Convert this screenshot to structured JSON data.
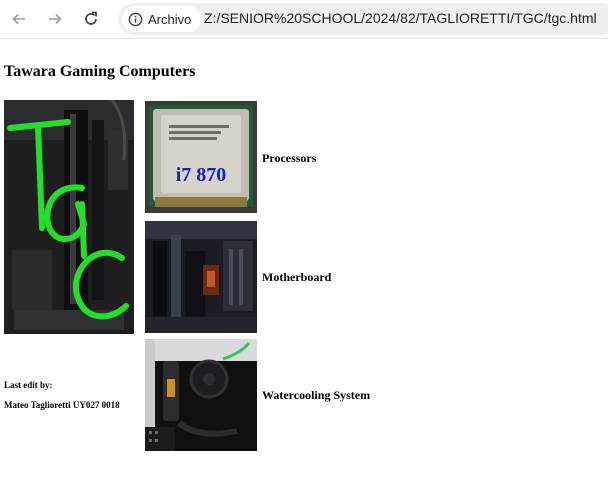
{
  "browser": {
    "site_chip_label": "Archivo",
    "url": "Z:/SENIOR%20SCHOOL/2024/82/TAGLIORETTI/TGC/tgc.html"
  },
  "page": {
    "title": "Tawara Gaming Computers",
    "logo_text": "TGC",
    "rows": [
      {
        "label": "Processors",
        "image_caption": "i7 870"
      },
      {
        "label": "Motherboard"
      },
      {
        "label": "Watercooling System"
      }
    ],
    "footer": {
      "line1": "Last edit by:",
      "line2": "Mateo Taglioretti UY027 0018"
    }
  },
  "colors": {
    "logo_green": "#22e027",
    "cpu_text_blue": "#1420c8"
  }
}
